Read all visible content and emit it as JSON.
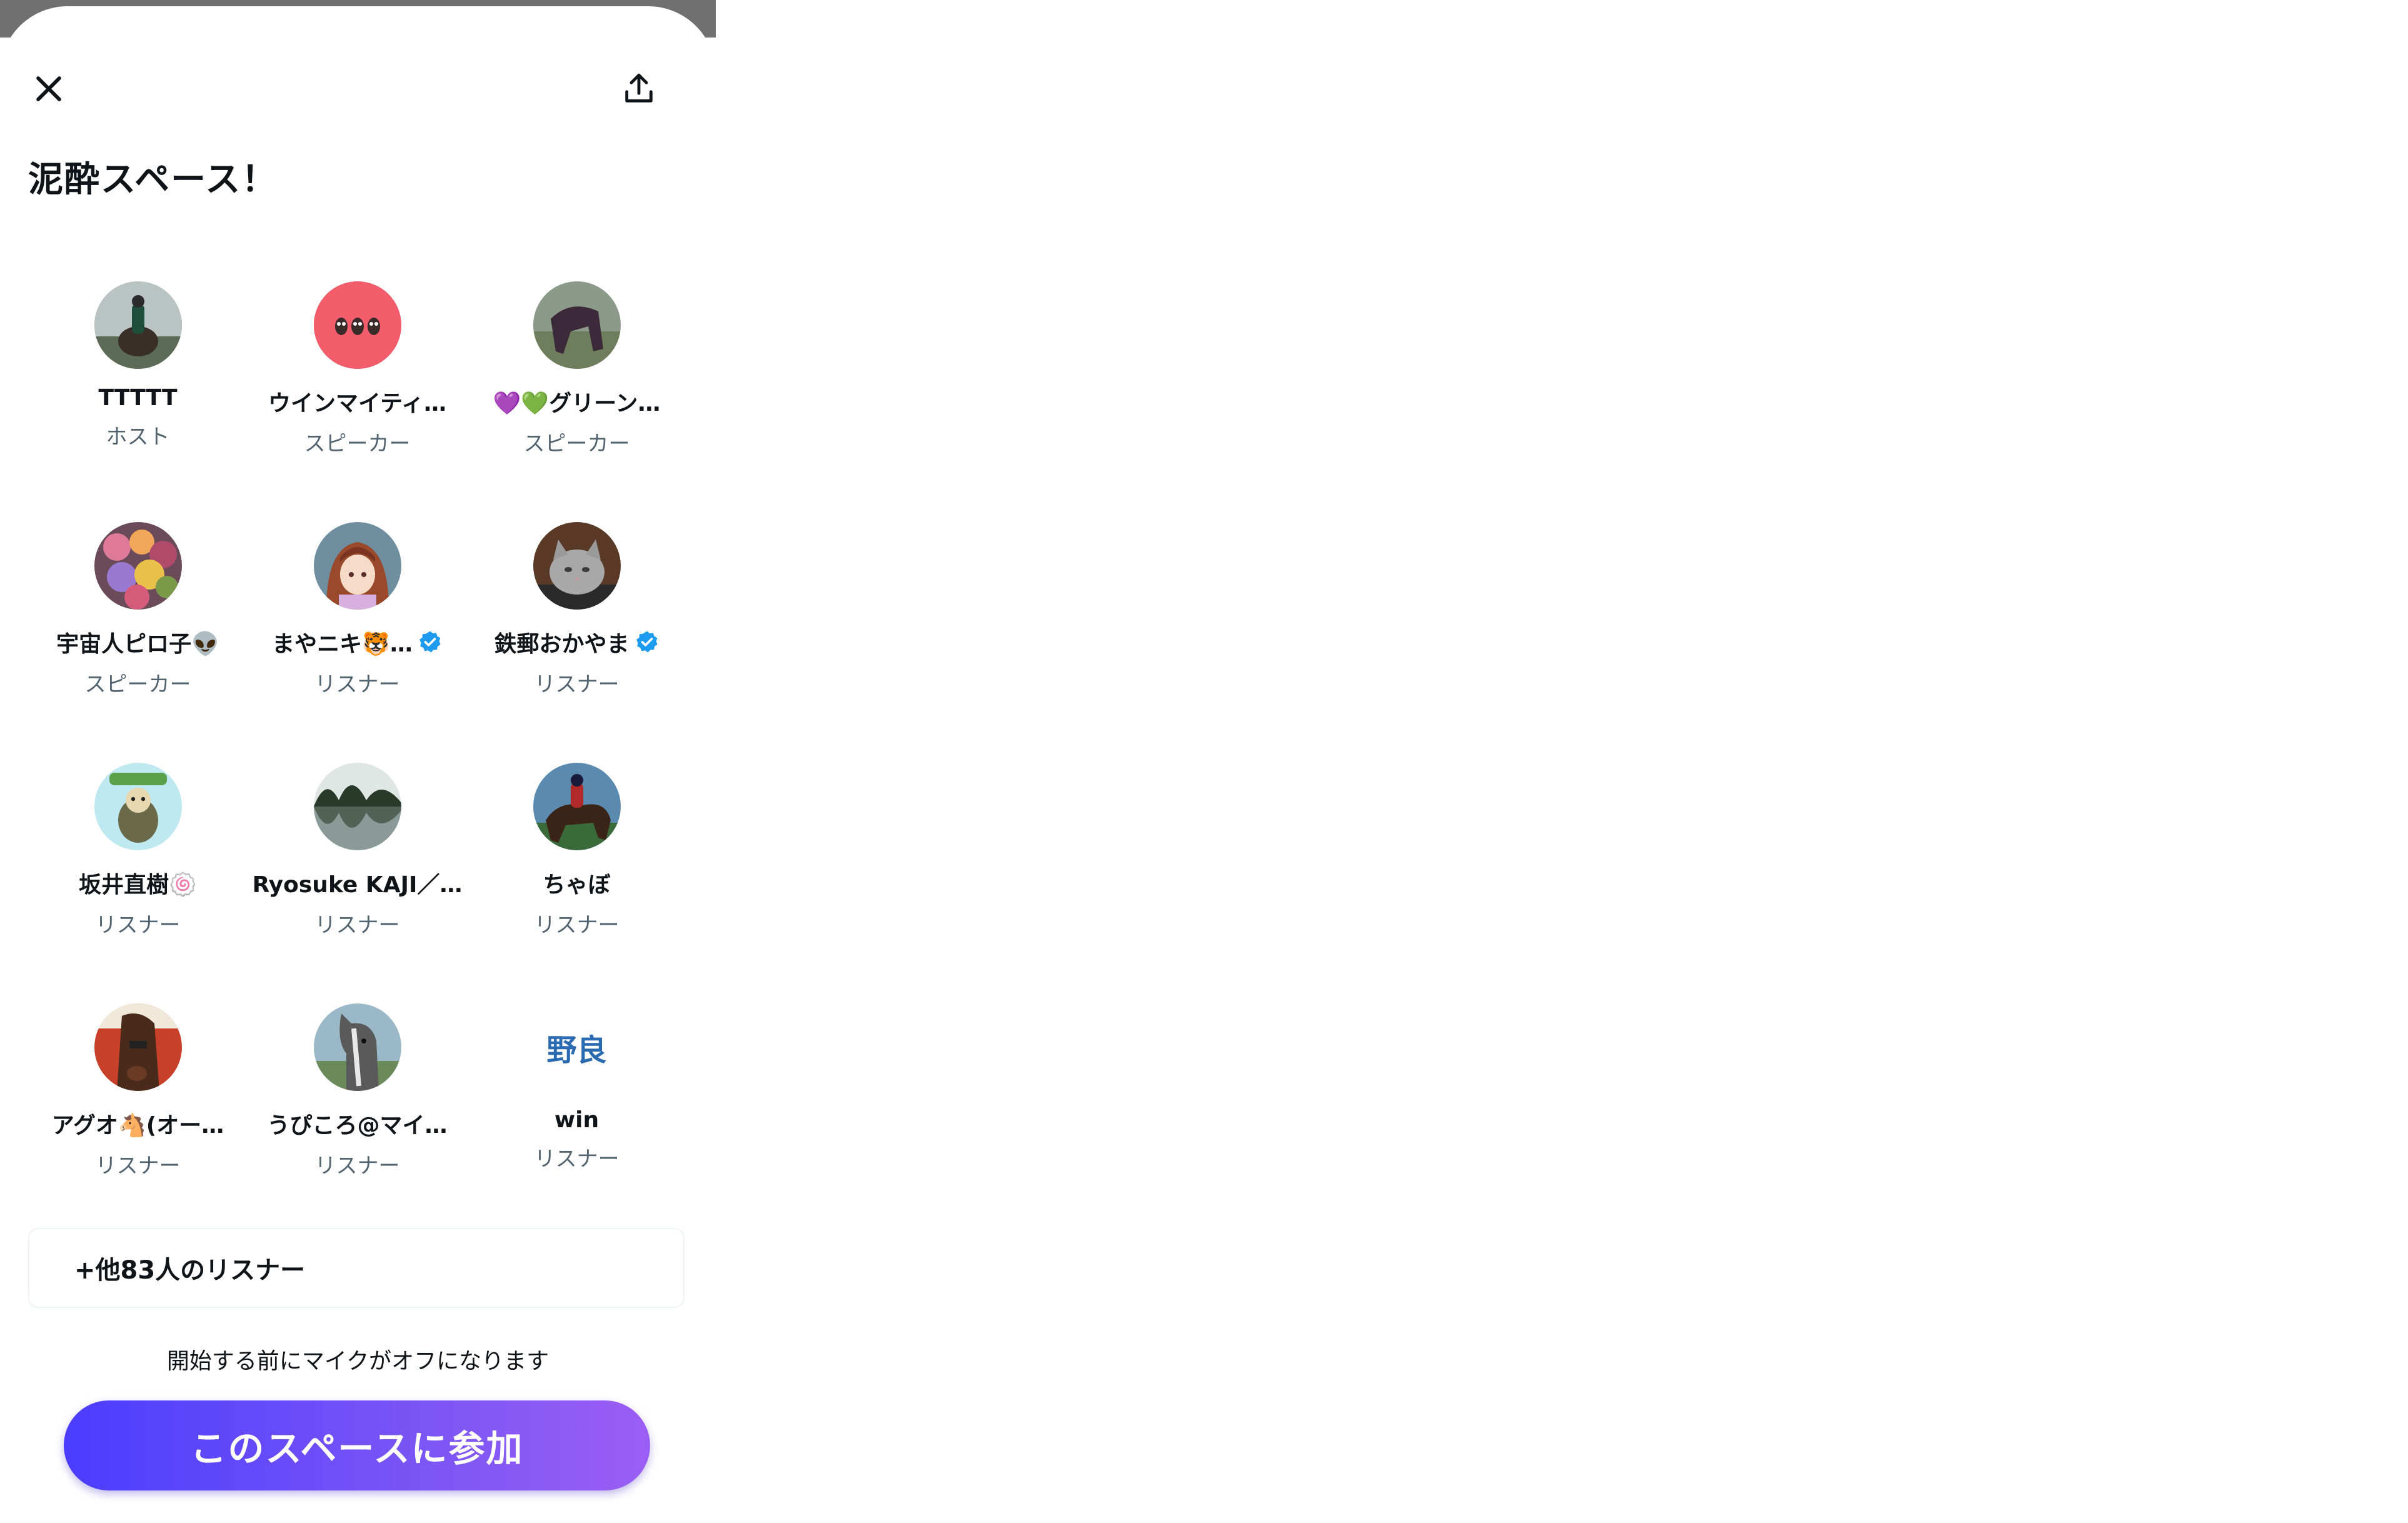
{
  "space": {
    "title": "泥酔スペース！",
    "more_listeners_label": "+他83人のリスナー",
    "mic_note": "開始する前にマイクがオフになります",
    "join_label": "このスペースに参加"
  },
  "colors": {
    "accent_gradient_start": "#4a3dff",
    "accent_gradient_end": "#9b5ef4",
    "verified": "#1d9bf0",
    "role_text": "#536471"
  },
  "participants": [
    {
      "name": "TTTTT",
      "role": "ホスト",
      "verified": false,
      "avatar": "jockey-on-horse"
    },
    {
      "name": "ウインマイティ…",
      "role": "スピーカー",
      "verified": false,
      "avatar": "red-circle-owls"
    },
    {
      "name": "💜💚グリーン…",
      "role": "スピーカー",
      "verified": false,
      "avatar": "horse-grazing"
    },
    {
      "name": "宇宙人ピロ子👽",
      "role": "スピーカー",
      "verified": false,
      "avatar": "flower-bouquet"
    },
    {
      "name": "まやニキ🐯…",
      "role": "リスナー",
      "verified": true,
      "avatar": "anime-horse-girl"
    },
    {
      "name": "鉄郵おかやま",
      "role": "リスナー",
      "verified": true,
      "avatar": "grey-cat"
    },
    {
      "name": "坂井直樹🍥",
      "role": "リスナー",
      "verified": false,
      "avatar": "cartoon-character"
    },
    {
      "name": "Ryosuke KAJI／…",
      "role": "リスナー",
      "verified": false,
      "avatar": "lake-reflection"
    },
    {
      "name": "ちゃぼ",
      "role": "リスナー",
      "verified": false,
      "avatar": "jockey-racing"
    },
    {
      "name": "アグオ🐴(オー…",
      "role": "リスナー",
      "verified": false,
      "avatar": "racehorse-closeup"
    },
    {
      "name": "うぴころ@マイ…",
      "role": "リスナー",
      "verified": false,
      "avatar": "grey-horse-head"
    },
    {
      "name": "win",
      "role": "リスナー",
      "verified": false,
      "avatar": "calligraphy-text",
      "avatar_text": "野良"
    }
  ]
}
